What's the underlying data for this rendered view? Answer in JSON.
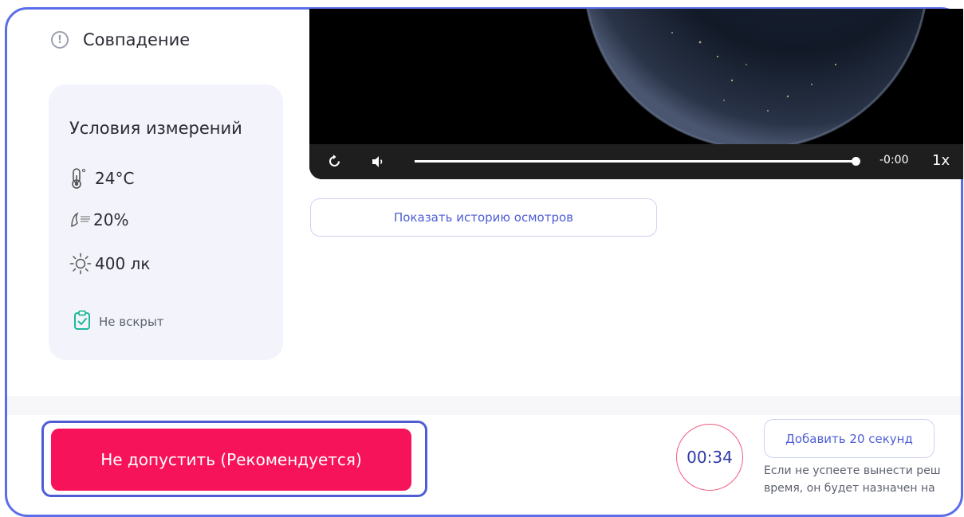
{
  "status": {
    "label": "Совпадение",
    "icon": "exclamation-circle-icon"
  },
  "conditions": {
    "title": "Условия измерений",
    "temperature": "24°C",
    "humidity": "20%",
    "illumination": "400 лк",
    "seal_status": "Не вскрыт",
    "colors": {
      "card_bg": "#f3f4fb",
      "seal_icon": "#1fb89a"
    }
  },
  "video": {
    "time": "-0:00",
    "speed": "1x",
    "progress": 1.0,
    "icons": [
      "replay-icon",
      "volume-icon"
    ]
  },
  "history_button": {
    "label": "Показать историю осмотров"
  },
  "actions": {
    "reject_label": "Не допустить (Рекомендуется)",
    "timer": "00:34",
    "add_time_label": "Добавить 20 секунд",
    "hint_line1": "Если не успеете вынести реш",
    "hint_line2": "время, он будет назначен на"
  },
  "colors": {
    "accent": "#4e5dd4",
    "danger": "#f7135a",
    "frame": "#5b6ee8"
  }
}
